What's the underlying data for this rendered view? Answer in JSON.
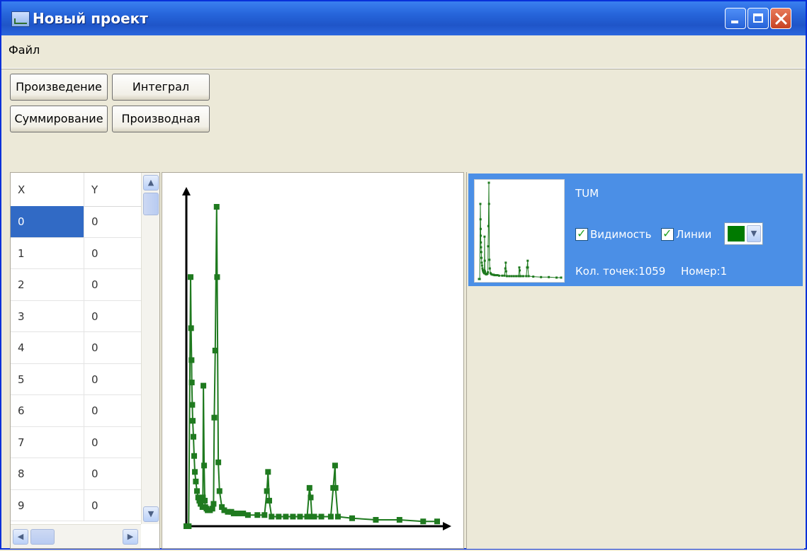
{
  "window": {
    "title": "Новый проект",
    "icon": "chart-app-icon"
  },
  "menu": {
    "items": [
      "Файл"
    ]
  },
  "toolbar": {
    "product": "Произведение",
    "integral": "Интеграл",
    "sum": "Суммирование",
    "derivative": "Производная"
  },
  "table": {
    "headers": {
      "x": "X",
      "y": "Y"
    },
    "selected_row": 0,
    "rows": [
      {
        "x": "0",
        "y": "0"
      },
      {
        "x": "1",
        "y": "0"
      },
      {
        "x": "2",
        "y": "0"
      },
      {
        "x": "3",
        "y": "0"
      },
      {
        "x": "4",
        "y": "0"
      },
      {
        "x": "5",
        "y": "0"
      },
      {
        "x": "6",
        "y": "0"
      },
      {
        "x": "7",
        "y": "0"
      },
      {
        "x": "8",
        "y": "0"
      },
      {
        "x": "9",
        "y": "0"
      }
    ]
  },
  "series": {
    "name": "TUM",
    "visibility_label": "Видимость",
    "visibility_checked": true,
    "lines_label": "Линии",
    "lines_checked": true,
    "color": "#007a00",
    "points_label": "Кол. точек:1059",
    "number_label": "Номер:1"
  },
  "colors": {
    "selection": "#316ac5",
    "series_panel": "#4b8fe6",
    "plot": "#1f7a1f"
  },
  "chart_data": {
    "type": "line",
    "title": "",
    "xlabel": "",
    "ylabel": "",
    "xlim": [
      0,
      1059
    ],
    "ylim": [
      0,
      100
    ],
    "grid": false,
    "series": [
      {
        "x": [
          0,
          10,
          18,
          20,
          22,
          23,
          25,
          27,
          30,
          33,
          36,
          40,
          45,
          50,
          55,
          60,
          68,
          70,
          72,
          75,
          78,
          80,
          85,
          90,
          95,
          100,
          110,
          115,
          118,
          122,
          128,
          130,
          135,
          140,
          150,
          160,
          175,
          190,
          200,
          220,
          240,
          260,
          300,
          330,
          340,
          345,
          350,
          360,
          390,
          420,
          450,
          480,
          510,
          520,
          525,
          530,
          540,
          570,
          610,
          620,
          628,
          630,
          640,
          700,
          800,
          900,
          1000,
          1059
        ],
        "y": [
          0,
          0,
          78,
          62,
          52,
          45,
          38,
          33,
          28,
          22,
          17,
          14,
          11,
          9,
          8,
          7,
          6,
          9,
          44,
          19,
          8,
          6,
          5.5,
          5,
          5,
          5,
          5.5,
          7,
          34,
          55,
          100,
          78,
          20,
          11,
          6,
          5,
          4.5,
          4.5,
          4,
          4,
          4,
          3.5,
          3.5,
          3.5,
          11,
          17,
          8,
          3,
          3,
          3,
          3,
          3,
          3,
          12,
          9,
          3,
          3,
          3,
          3,
          12,
          19,
          12,
          3,
          2.5,
          2,
          2,
          1.5,
          1.5
        ]
      }
    ]
  }
}
